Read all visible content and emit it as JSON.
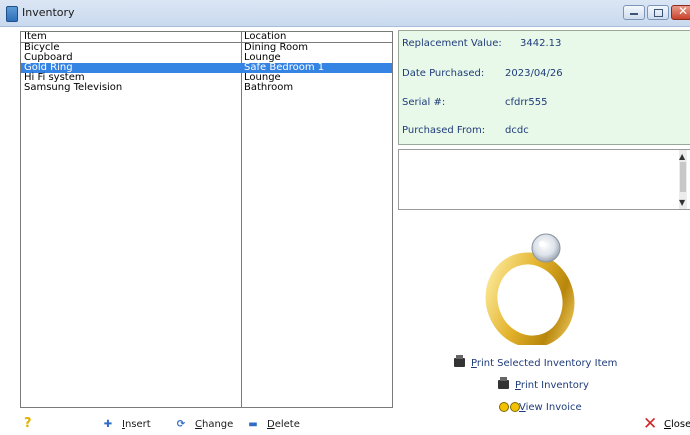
{
  "window": {
    "title": "Inventory"
  },
  "list": {
    "headers": {
      "item": "Item",
      "location": "Location"
    },
    "rows": [
      {
        "item": "Bicycle",
        "location": "Dining Room"
      },
      {
        "item": "Cupboard",
        "location": "Lounge"
      },
      {
        "item": "Gold Ring",
        "location": "Safe Bedroom 1"
      },
      {
        "item": "Hi Fi system",
        "location": "Lounge"
      },
      {
        "item": "Samsung Television",
        "location": "Bathroom"
      }
    ]
  },
  "details": {
    "replacement_value_label": "Replacement Value:",
    "replacement_value": "3442.13",
    "date_purchased_label": "Date Purchased:",
    "date_purchased": "2023/04/26",
    "serial_label": "Serial #:",
    "serial": "cfdrr555",
    "purchased_from_label": "Purchased From:",
    "purchased_from": "dcdc"
  },
  "actions": {
    "print_selected_underlined": "P",
    "print_selected_rest": "rint Selected Inventory Item",
    "print_inventory_underlined": "P",
    "print_inventory_rest": "rint Inventory",
    "view_invoice_underlined": "V",
    "view_invoice_rest": "iew Invoice"
  },
  "toolbar": {
    "help_glyph": "?",
    "insert_underlined": "I",
    "insert_rest": "nsert",
    "change_underlined": "C",
    "change_rest": "hange",
    "delete_underlined": "D",
    "delete_rest": "elete",
    "close_underlined": "C",
    "close_rest": "lose"
  }
}
